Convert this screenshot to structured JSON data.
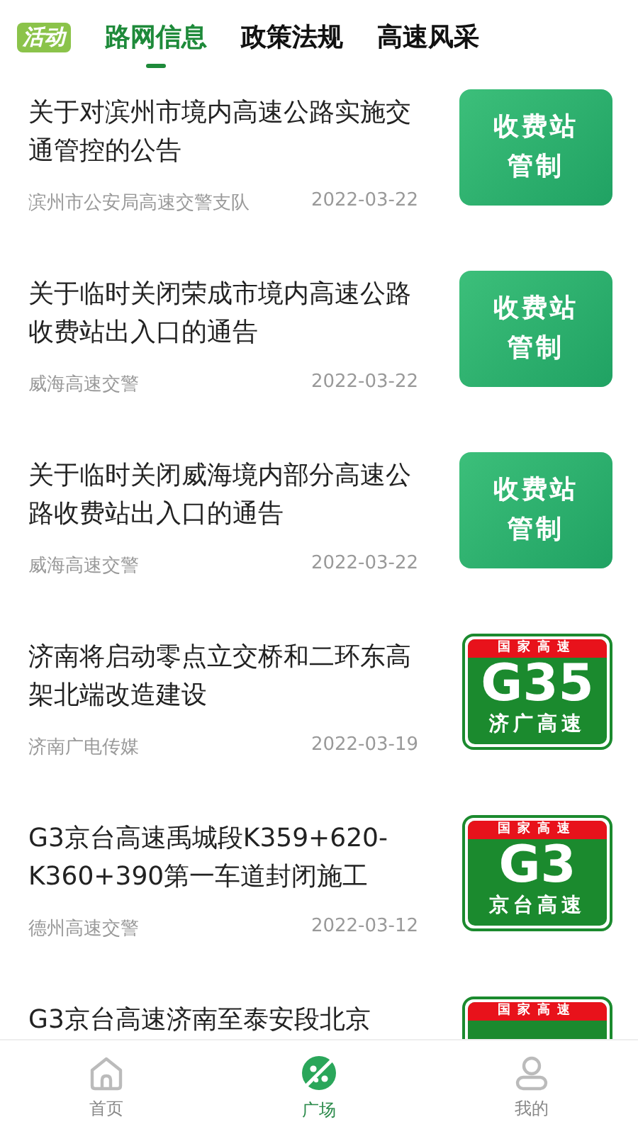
{
  "header": {
    "logo": "活动",
    "tabs": [
      {
        "label": "路网信息",
        "selected": true
      },
      {
        "label": "政策法规",
        "selected": false
      },
      {
        "label": "高速风采",
        "selected": false
      }
    ]
  },
  "articles": [
    {
      "title": "关于对滨州市境内高速公路实施交通管控的公告",
      "source": "滨州市公安局高速交警支队",
      "date": "2022-03-22",
      "thumb": {
        "kind": "card",
        "lines": [
          "收费站",
          "管制"
        ]
      }
    },
    {
      "title": "关于临时关闭荣成市境内高速公路收费站出入口的通告",
      "source": "威海高速交警",
      "date": "2022-03-22",
      "thumb": {
        "kind": "card",
        "lines": [
          "收费站",
          "管制"
        ]
      }
    },
    {
      "title": "关于临时关闭威海境内部分高速公路收费站出入口的通告",
      "source": "威海高速交警",
      "date": "2022-03-22",
      "thumb": {
        "kind": "card",
        "lines": [
          "收费站",
          "管制"
        ]
      }
    },
    {
      "title": "济南将启动零点立交桥和二环东高架北端改造建设",
      "source": "济南广电传媒",
      "date": "2022-03-19",
      "thumb": {
        "kind": "sign",
        "top": "国家高速",
        "number": "G35",
        "name": "济广高速"
      }
    },
    {
      "title": "G3京台高速禹城段K359+620-K360+390第一车道封闭施工",
      "source": "德州高速交警",
      "date": "2022-03-12",
      "thumb": {
        "kind": "sign",
        "top": "国家高速",
        "number": "G3",
        "name": "京台高速"
      }
    },
    {
      "title": "G3京台高速济南至泰安段北京",
      "thumb": {
        "kind": "sign",
        "top": "国家高速"
      }
    }
  ],
  "nav": [
    {
      "label": "首页",
      "kind": "home",
      "selected": false
    },
    {
      "label": "广场",
      "kind": "planet",
      "selected": true
    },
    {
      "label": "我的",
      "kind": "person",
      "selected": false
    }
  ]
}
